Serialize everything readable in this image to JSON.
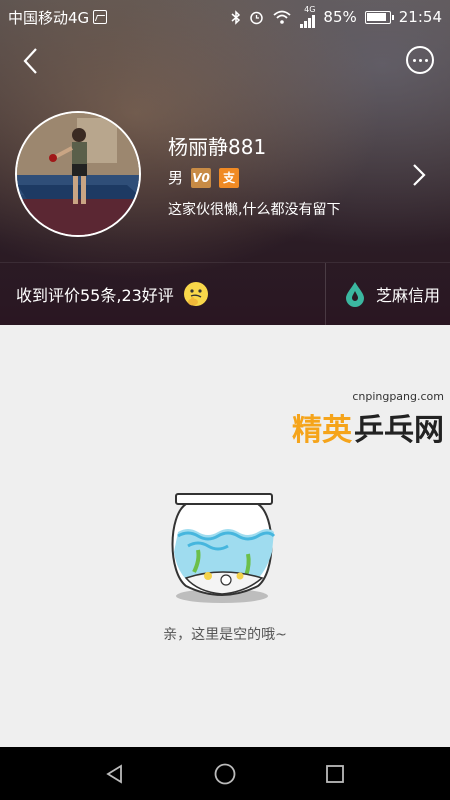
{
  "status_bar": {
    "carrier": "中国移动4G",
    "network_label": "4G",
    "battery_percent": "85%",
    "time": "21:54"
  },
  "profile": {
    "name": "杨丽静881",
    "gender": "男",
    "level_badge": "V0",
    "alipay_badge": "支",
    "bio": "这家伙很懒,什么都没有留下"
  },
  "reviews": {
    "summary": "收到评价55条,23好评"
  },
  "sesame_credit": {
    "label": "芝麻信用"
  },
  "empty_state": {
    "message": "亲，这里是空的哦~"
  },
  "watermark": {
    "url": "cnpingpang.com",
    "brand_accent": "精英",
    "brand_main": "乒乓网"
  },
  "colors": {
    "accent_orange": "#f08a24",
    "sesame_green": "#3bb7a0"
  }
}
